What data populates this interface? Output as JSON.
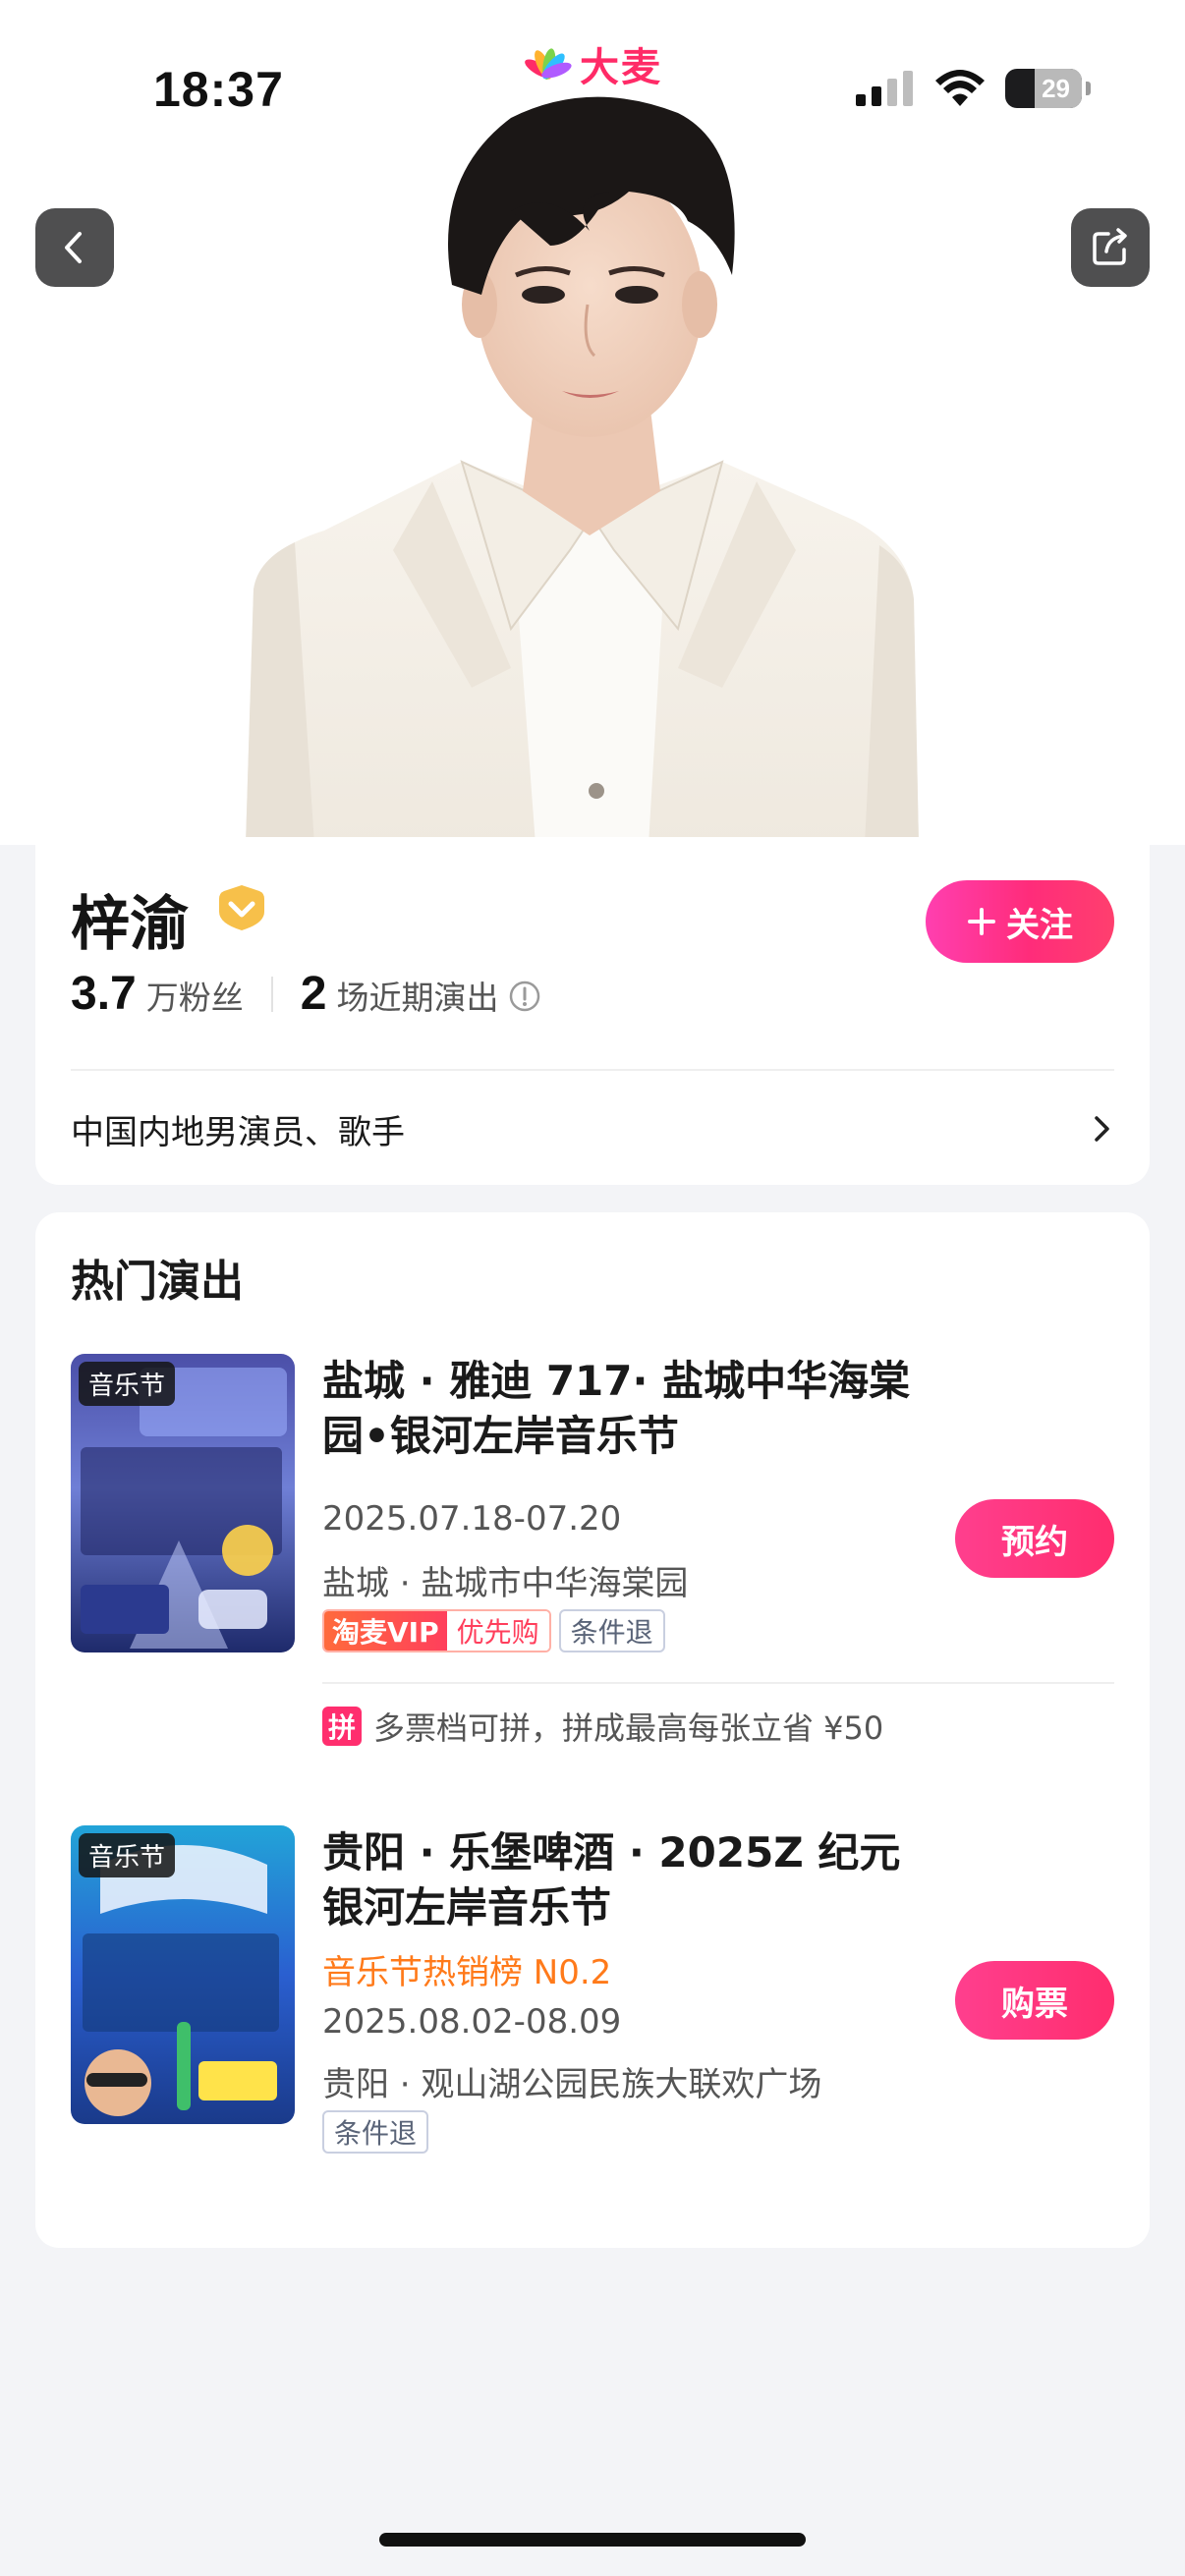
{
  "status_bar": {
    "time": "18:37",
    "battery": "29"
  },
  "brand": {
    "name": "大麦",
    "colors": [
      "#ff2b67",
      "#ffb22e",
      "#2ec0ff",
      "#7bd34b",
      "#b05bff"
    ]
  },
  "hero": {
    "back_icon": "chevron-left-icon",
    "share_icon": "share-icon"
  },
  "artist": {
    "name": "梓渝",
    "fans_number": "3.7",
    "fans_unit": "万粉丝",
    "shows_number": "2",
    "shows_unit": "场近期演出",
    "follow_label": "关注",
    "intro": "中国内地男演员、歌手"
  },
  "hot_shows": {
    "title": "热门演出",
    "items": [
      {
        "poster_tag": "音乐节",
        "title": "盐城 · 雅迪 717· 盐城中华海棠园•银河左岸音乐节",
        "date": "2025.07.18-07.20",
        "venue": "盐城 · 盐城市中华海棠园",
        "vip_tag": "淘麦VIP",
        "priority_tag": "优先购",
        "refund_tag": "条件退",
        "action": "预约",
        "pin_badge": "拼",
        "pin_text": "多票档可拼，拼成最高每张立省 ¥50"
      },
      {
        "poster_tag": "音乐节",
        "title": "贵阳 · 乐堡啤酒 · 2025Z 纪元银河左岸音乐节",
        "hot_rank": "音乐节热销榜 N0.2",
        "date": "2025.08.02-08.09",
        "venue": "贵阳 · 观山湖公园民族大联欢广场",
        "refund_tag": "条件退",
        "action": "购票"
      }
    ]
  }
}
